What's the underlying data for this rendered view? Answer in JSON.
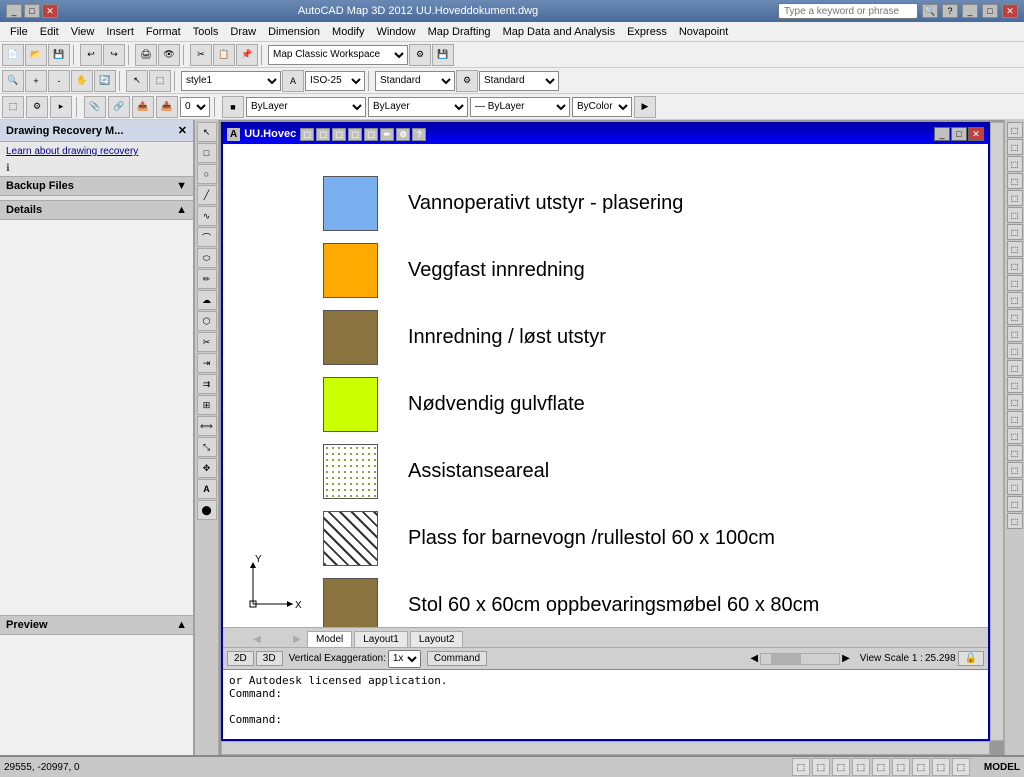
{
  "app": {
    "title": "AutoCAD Map 3D 2012    UU.Hoveddokument.dwg",
    "search_placeholder": "Type a keyword or phrase"
  },
  "menu": {
    "items": [
      "File",
      "Edit",
      "View",
      "Insert",
      "Format",
      "Tools",
      "Draw",
      "Dimension",
      "Modify",
      "Window",
      "Map Drafting",
      "Map Data and Analysis",
      "Express",
      "Novapoint"
    ]
  },
  "toolbar1": {
    "workspace_label": "Map Classic Workspace",
    "combo1": "0",
    "combo2": "ByLayer",
    "combo3": "ByLayer",
    "combo4": "ByLayer",
    "combo5": "ByColor",
    "style1": "style1",
    "iso": "ISO-25",
    "standard1": "Standard",
    "standard2": "Standard"
  },
  "left_panel": {
    "title": "Drawing Recovery M...",
    "recovery_link": "Learn about drawing recovery",
    "backup_files_label": "Backup Files",
    "details_label": "Details",
    "preview_label": "Preview"
  },
  "inner_window": {
    "title": "UU.Hovec",
    "toolbar_icons": [
      "icon1",
      "icon2",
      "icon3",
      "icon4",
      "icon5",
      "icon6",
      "icon7",
      "icon8",
      "icon9"
    ]
  },
  "legend": {
    "items": [
      {
        "color": "#7ab0f0",
        "label": "Vannoperativt utstyr - plasering",
        "type": "solid"
      },
      {
        "color": "#ffaa00",
        "label": "Veggfast innredning",
        "type": "solid"
      },
      {
        "color": "#8b7340",
        "label": "Innredning / løst utstyr",
        "type": "solid"
      },
      {
        "color": "#ccff00",
        "label": "Nødvendig gulvflate",
        "type": "solid"
      },
      {
        "color": "dotted",
        "label": "Assistanseareal",
        "type": "dotted"
      },
      {
        "color": "hatched",
        "label": "Plass for barnevogn /rullestol 60 x 100cm",
        "type": "hatched"
      },
      {
        "color": "#8b7340",
        "label": "Stol 60 x 60cm oppbevaringsmøbel 60 x 80cm",
        "type": "solid2"
      }
    ]
  },
  "tabs": {
    "items": [
      "Model",
      "Layout1",
      "Layout2"
    ]
  },
  "view_bar": {
    "btn2d": "2D",
    "btn3d": "3D",
    "vertical_label": "Vertical Exaggeration:",
    "vertical_val": "1x",
    "command_label": "Command",
    "view_scale": "View Scale 1 :",
    "view_scale_val": "25.298"
  },
  "command_area": {
    "line1": "or Autodesk licensed application.",
    "line2": "Command:",
    "line3": "",
    "line4": "Command:"
  },
  "bottom_status": {
    "coords": "29555, -20997, 0",
    "model_label": "MODEL"
  },
  "left_tools": [
    "▶",
    "⬜",
    "⬜",
    "⬜",
    "⬜",
    "⬜",
    "⬜",
    "⬜",
    "⬜",
    "⬜",
    "⬜",
    "⬜",
    "⬜",
    "⬜",
    "⬜",
    "⬜",
    "⬜",
    "A",
    "⬤"
  ],
  "right_tools": [
    "⬜",
    "⬜",
    "⬜",
    "⬜",
    "⬜",
    "⬜",
    "⬜",
    "⬜",
    "⬜",
    "⬜",
    "⬜",
    "⬜",
    "⬜",
    "⬜",
    "⬜",
    "⬜",
    "⬜",
    "⬜",
    "⬜",
    "⬜",
    "⬜",
    "⬜",
    "⬜",
    "⬜"
  ]
}
